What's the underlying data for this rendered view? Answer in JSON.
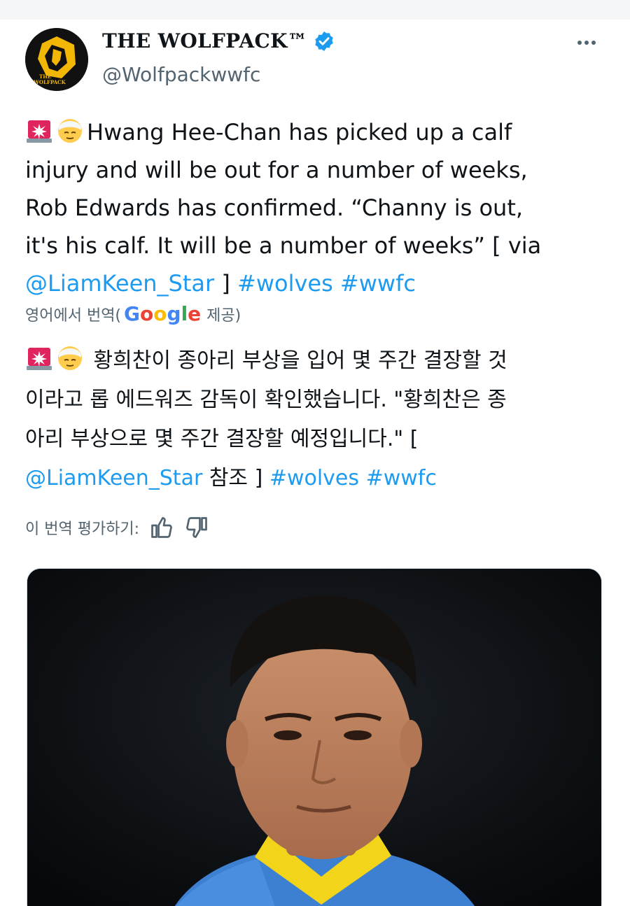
{
  "tweet": {
    "display_name": "THE WOLFPACK™",
    "handle": "@Wolfpackwwfc",
    "avatar_logo_text": "THE WOLFPACK",
    "more_icon": "more-horizontal-icon",
    "verified_icon": "verified-badge-icon",
    "verified_color": "#1d9bf0",
    "original_text": {
      "line1": "Hwang Hee-Chan has picked up a calf",
      "line2": "injury and will be out for a number of weeks,",
      "line3": "Rob Edwards has confirmed. “Channy is out,",
      "line4": "it's his calf. It will be a number of weeks” [ via",
      "mention": "@LiamKeen_Star",
      "line5_mid": " ] ",
      "hashtag1": "#wolves",
      "hashtag2": "#wwfc"
    },
    "translate_label_prefix": "영어에서 번역(",
    "translate_provider": "Google",
    "translate_label_suffix": "제공)",
    "translated_text": {
      "line1": "황희찬이 종아리 부상을 입어 몇 주간 결장할 것",
      "line2": "이라고 롭 에드워즈 감독이 확인했습니다. \"황희찬은 종",
      "line3": "아리 부상으로 몇 주간 결장할 예정입니다.\" [",
      "mention": "@LiamKeen_Star",
      "ref": " 참조 ] ",
      "hashtag1": "#wolves",
      "hashtag2": "#wwfc"
    },
    "rate_label": "이 번역 평가하기:",
    "emojis": [
      "rotating-light-emoji",
      "face-with-head-bandage-emoji"
    ],
    "colors": {
      "link": "#1d9bf0",
      "text": "#0f1419",
      "secondary": "#536471"
    }
  }
}
